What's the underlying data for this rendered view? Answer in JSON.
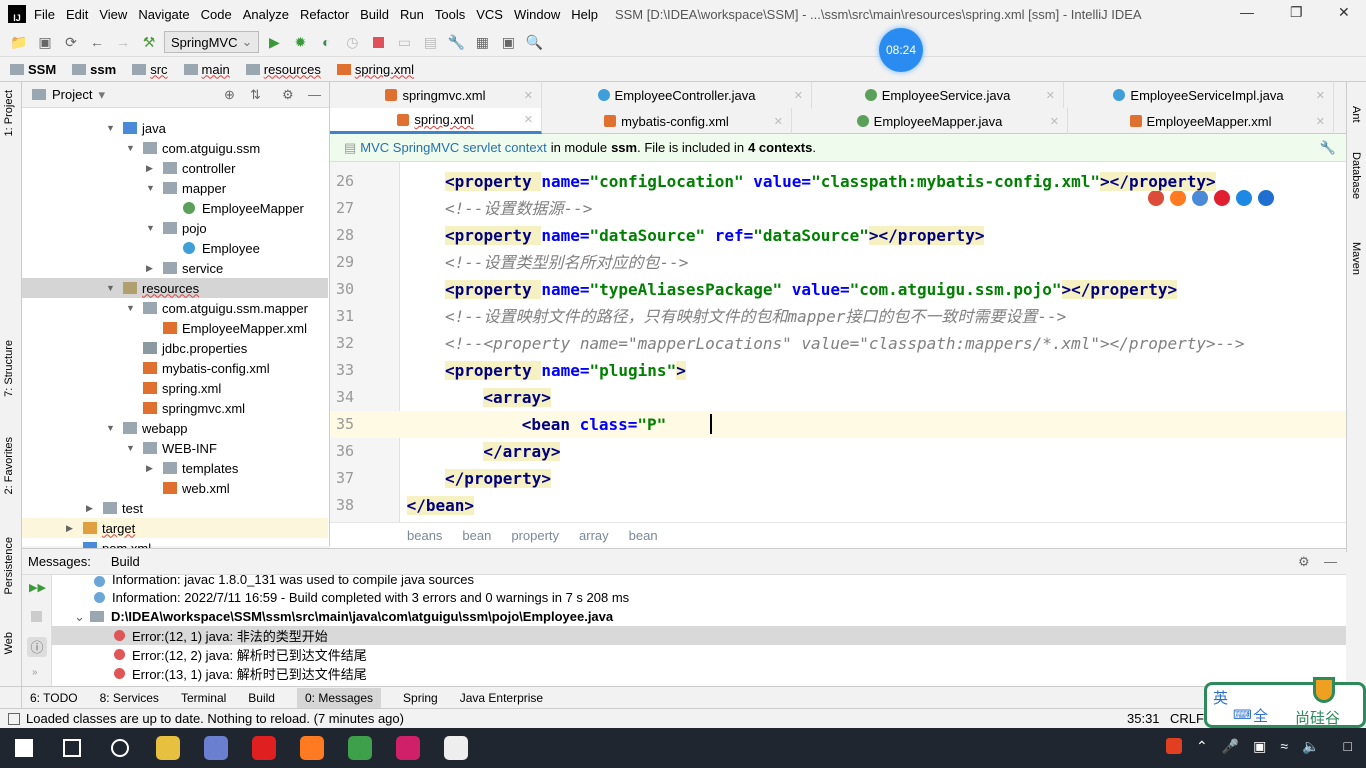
{
  "window": {
    "title": "SSM [D:\\IDEA\\workspace\\SSM] - ...\\ssm\\src\\main\\resources\\spring.xml [ssm] - IntelliJ IDEA",
    "logo": "IJ"
  },
  "menu": [
    "File",
    "Edit",
    "View",
    "Navigate",
    "Code",
    "Analyze",
    "Refactor",
    "Build",
    "Run",
    "Tools",
    "VCS",
    "Window",
    "Help"
  ],
  "toolbar": {
    "run_config": "SpringMVC"
  },
  "clock": "08:24",
  "breadcrumb": [
    "SSM",
    "ssm",
    "src",
    "main",
    "resources",
    "spring.xml"
  ],
  "left_stripe": [
    "1: Project",
    "7: Structure",
    "2: Favorites",
    "Persistence",
    "Web"
  ],
  "right_stripe": [
    "Ant",
    "Database",
    "Maven"
  ],
  "project": {
    "title": "Project",
    "tree": [
      {
        "label": "java",
        "level": 2,
        "arrow": "open",
        "icon": "source-folder"
      },
      {
        "label": "com.atguigu.ssm",
        "level": 3,
        "arrow": "open",
        "icon": "package"
      },
      {
        "label": "controller",
        "level": 4,
        "arrow": "closed",
        "icon": "package"
      },
      {
        "label": "mapper",
        "level": 4,
        "arrow": "open",
        "icon": "package"
      },
      {
        "label": "EmployeeMapper",
        "level": 5,
        "icon": "interface"
      },
      {
        "label": "pojo",
        "level": 4,
        "arrow": "open",
        "icon": "package"
      },
      {
        "label": "Employee",
        "level": 5,
        "icon": "class"
      },
      {
        "label": "service",
        "level": 4,
        "arrow": "closed",
        "icon": "package"
      },
      {
        "label": "resources",
        "level": 2,
        "arrow": "open",
        "icon": "resources-folder",
        "selected": true
      },
      {
        "label": "com.atguigu.ssm.mapper",
        "level": 3,
        "arrow": "open",
        "icon": "folder"
      },
      {
        "label": "EmployeeMapper.xml",
        "level": 4,
        "icon": "xml"
      },
      {
        "label": "jdbc.properties",
        "level": 3,
        "icon": "properties"
      },
      {
        "label": "mybatis-config.xml",
        "level": 3,
        "icon": "xml"
      },
      {
        "label": "spring.xml",
        "level": 3,
        "icon": "xml"
      },
      {
        "label": "springmvc.xml",
        "level": 3,
        "icon": "xml"
      },
      {
        "label": "webapp",
        "level": 2,
        "arrow": "open",
        "icon": "folder"
      },
      {
        "label": "WEB-INF",
        "level": 3,
        "arrow": "open",
        "icon": "folder"
      },
      {
        "label": "templates",
        "level": 4,
        "arrow": "closed",
        "icon": "folder"
      },
      {
        "label": "web.xml",
        "level": 4,
        "icon": "xml"
      },
      {
        "label": "test",
        "level": 1,
        "arrow": "closed",
        "icon": "folder"
      },
      {
        "label": "target",
        "level": 0,
        "arrow": "closed",
        "icon": "excluded-folder",
        "highlight": true
      },
      {
        "label": "pom.xml",
        "level": 0,
        "icon": "maven"
      }
    ]
  },
  "tabs_row1": [
    {
      "label": "springmvc.xml",
      "icon": "xml"
    },
    {
      "label": "EmployeeController.java",
      "icon": "class"
    },
    {
      "label": "EmployeeService.java",
      "icon": "interface"
    },
    {
      "label": "EmployeeServiceImpl.java",
      "icon": "class"
    }
  ],
  "tabs_row2": [
    {
      "label": "spring.xml",
      "icon": "xml",
      "active": true
    },
    {
      "label": "mybatis-config.xml",
      "icon": "xml"
    },
    {
      "label": "EmployeeMapper.java",
      "icon": "interface"
    },
    {
      "label": "EmployeeMapper.xml",
      "icon": "xml"
    }
  ],
  "notice": {
    "link": "MVC SpringMVC servlet context",
    "t1": "in module",
    "module": "ssm",
    "t2": ". File is included in",
    "count": "4 contexts",
    "t3": "."
  },
  "code": [
    {
      "n": "26",
      "indent": 3,
      "parts": [
        [
          "t",
          "<property "
        ],
        [
          "a",
          "name="
        ],
        [
          "v",
          "\"configLocation\""
        ],
        [
          "a",
          " value="
        ],
        [
          "v",
          "\"classpath:mybatis-config.xml\""
        ],
        [
          "t",
          "></property>"
        ]
      ]
    },
    {
      "n": "27",
      "indent": 3,
      "parts": [
        [
          "c",
          "<!--设置数据源-->"
        ]
      ]
    },
    {
      "n": "28",
      "indent": 3,
      "parts": [
        [
          "t",
          "<property "
        ],
        [
          "a",
          "name="
        ],
        [
          "v",
          "\"dataSource\""
        ],
        [
          "a",
          " ref="
        ],
        [
          "v",
          "\"dataSource\""
        ],
        [
          "t",
          "></property>"
        ]
      ]
    },
    {
      "n": "29",
      "indent": 3,
      "parts": [
        [
          "c",
          "<!--设置类型别名所对应的包-->"
        ]
      ]
    },
    {
      "n": "30",
      "indent": 3,
      "parts": [
        [
          "t",
          "<property "
        ],
        [
          "a",
          "name="
        ],
        [
          "v",
          "\"typeAliasesPackage\""
        ],
        [
          "a",
          " value="
        ],
        [
          "v",
          "\"com.atguigu.ssm.pojo\""
        ],
        [
          "t",
          "></property>"
        ]
      ]
    },
    {
      "n": "31",
      "indent": 3,
      "parts": [
        [
          "c",
          "<!--设置映射文件的路径，只有映射文件的包和mapper接口的包不一致时需要设置-->"
        ]
      ]
    },
    {
      "n": "32",
      "indent": 3,
      "parts": [
        [
          "c",
          "<!--<property name=\"mapperLocations\" value=\"classpath:mappers/*.xml\"></property>-->"
        ]
      ]
    },
    {
      "n": "33",
      "indent": 3,
      "parts": [
        [
          "t",
          "<property "
        ],
        [
          "a",
          "name="
        ],
        [
          "v",
          "\"plugins\""
        ],
        [
          "t",
          ">"
        ]
      ]
    },
    {
      "n": "34",
      "indent": 4,
      "parts": [
        [
          "t",
          "<array>"
        ]
      ]
    },
    {
      "n": "35",
      "indent": 5,
      "current": true,
      "parts": [
        [
          "t",
          "<bean "
        ],
        [
          "a",
          "class="
        ],
        [
          "v",
          "\"P\""
        ]
      ]
    },
    {
      "n": "36",
      "indent": 4,
      "parts": [
        [
          "t",
          "</array>"
        ]
      ]
    },
    {
      "n": "37",
      "indent": 3,
      "parts": [
        [
          "t",
          "</property>"
        ]
      ]
    },
    {
      "n": "38",
      "indent": 2,
      "parts": [
        [
          "t",
          "</bean>"
        ]
      ]
    }
  ],
  "editor_breadcrumb": [
    "beans",
    "bean",
    "property",
    "array",
    "bean"
  ],
  "messages": {
    "tabs": [
      "Messages:",
      "Build"
    ],
    "rows": [
      {
        "type": "info",
        "text": "Information: javac 1.8.0_131 was used to compile java sources",
        "cut": true
      },
      {
        "type": "info",
        "text": "Information: 2022/7/11 16:59 - Build completed with 3 errors and 0 warnings in 7 s 208 ms"
      },
      {
        "type": "file",
        "text": "D:\\IDEA\\workspace\\SSM\\ssm\\src\\main\\java\\com\\atguigu\\ssm\\pojo\\Employee.java"
      },
      {
        "type": "error",
        "text": "Error:(12, 1)  java: 非法的类型开始",
        "selected": true
      },
      {
        "type": "error",
        "text": "Error:(12, 2)  java: 解析时已到达文件结尾"
      },
      {
        "type": "error",
        "text": "Error:(13, 1)  java: 解析时已到达文件结尾"
      }
    ]
  },
  "toolwindows": [
    {
      "label": "6: TODO"
    },
    {
      "label": "8: Services"
    },
    {
      "label": "Terminal"
    },
    {
      "label": "Build"
    },
    {
      "label": "0: Messages",
      "active": true
    },
    {
      "label": "Spring"
    },
    {
      "label": "Java Enterprise"
    }
  ],
  "status": {
    "message": "Loaded classes are up to date. Nothing to reload. (7 minutes ago)",
    "position": "35:31",
    "line_sep": "CRLF"
  },
  "ime": {
    "lang": "英",
    "width": "全",
    "brand": "尚硅谷"
  },
  "taskbar": [
    {
      "name": "windows-start",
      "color": "#fff"
    },
    {
      "name": "search",
      "color": "#fff"
    },
    {
      "name": "cortana",
      "color": "#fff"
    },
    {
      "name": "app-yellow",
      "color": "#e8c040"
    },
    {
      "name": "app-blue",
      "color": "#6a7fd0"
    },
    {
      "name": "youdao",
      "color": "#e02020"
    },
    {
      "name": "firefox",
      "color": "#ff7a20"
    },
    {
      "name": "chrome",
      "color": "#3ea04a"
    },
    {
      "name": "intellij",
      "color": "#d0206a"
    },
    {
      "name": "typora",
      "color": "#eeeeee"
    }
  ]
}
